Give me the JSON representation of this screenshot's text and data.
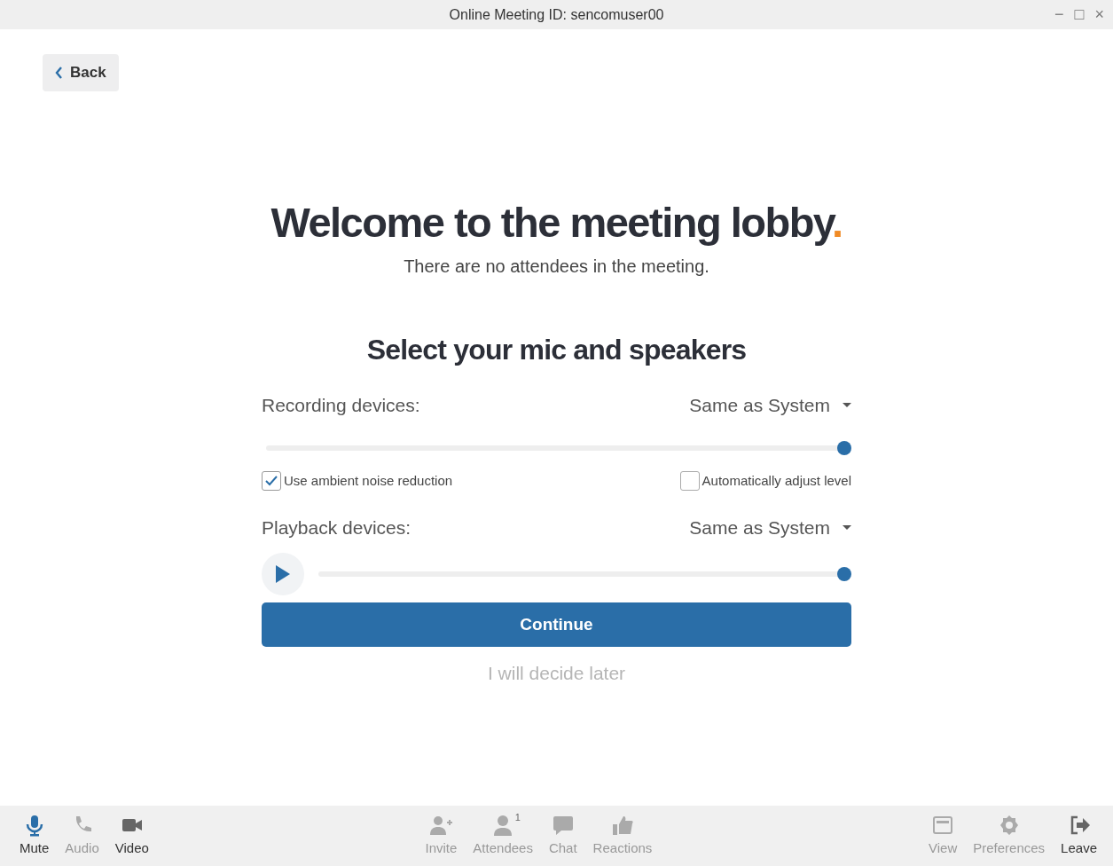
{
  "window": {
    "title": "Online Meeting ID: sencomuser00",
    "controls": [
      "−",
      "□",
      "×"
    ]
  },
  "back_button": {
    "label": "Back"
  },
  "heading": {
    "text": "Welcome to the meeting lobby",
    "end_mark": "."
  },
  "subtitle": "There are no attendees in the meeting.",
  "section_title": "Select your mic and speakers",
  "recording": {
    "label": "Recording devices:",
    "device": "Same as System",
    "level": 1
  },
  "options": [
    {
      "label": "Use ambient noise reduction",
      "checked": true
    },
    {
      "label": "Automatically adjust level",
      "checked": false
    }
  ],
  "playback": {
    "label": "Playback devices:",
    "device": "Same as System",
    "level": 1
  },
  "continue_button": "Continue",
  "later_link": "I will decide later",
  "toolbar": {
    "left": [
      {
        "kind": "mic",
        "label": "Mute",
        "enabled": true,
        "active": true
      },
      {
        "kind": "phone",
        "label": "Audio",
        "enabled": false,
        "active": false
      },
      {
        "kind": "camera",
        "label": "Video",
        "enabled": true,
        "active": false
      }
    ],
    "center": [
      {
        "kind": "invite",
        "label": "Invite",
        "enabled": false,
        "active": false
      },
      {
        "kind": "person",
        "label": "Attendees",
        "enabled": false,
        "active": false,
        "count": "1"
      },
      {
        "kind": "chat",
        "label": "Chat",
        "enabled": false,
        "active": false
      },
      {
        "kind": "thumb",
        "label": "Reactions",
        "enabled": false,
        "active": false
      }
    ],
    "right": [
      {
        "kind": "view",
        "label": "View",
        "enabled": false,
        "active": false
      },
      {
        "kind": "gear",
        "label": "Preferences",
        "enabled": false,
        "active": false
      },
      {
        "kind": "leave",
        "label": "Leave",
        "enabled": true,
        "active": false
      }
    ]
  }
}
